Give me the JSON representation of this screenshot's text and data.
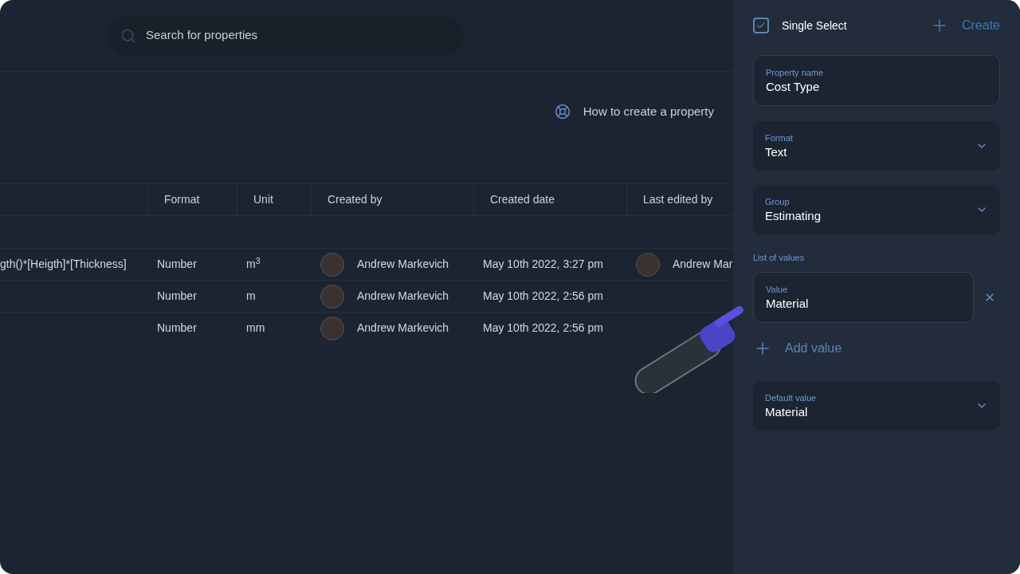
{
  "search": {
    "placeholder": "Search for properties"
  },
  "help_link": "How to create a property",
  "table": {
    "columns": [
      "Format",
      "Unit",
      "Created by",
      "Created date",
      "Last edited by"
    ],
    "rows": [
      {
        "column_1": "gth()*[Heigth]*[Thickness]",
        "format": "Number",
        "unit": "m$^{3}$",
        "created_by": "Andrew Markevich",
        "created_date": "May 10th 2022, 3:27 pm",
        "last_edited_by": "Andrew Mar"
      },
      {
        "format": "Number",
        "unit": "m",
        "created_by": "Andrew Markevich",
        "created_date": "May 10th 2022, 2:56 pm"
      },
      {
        "format": "Number",
        "unit": "mm",
        "created_by": "Andrew Markevich",
        "created_date": "May 10th 2022, 2:56 pm"
      }
    ]
  },
  "panel": {
    "single_select": {
      "label": "Single Select",
      "checked": true
    },
    "create_button": "Create",
    "property_name": {
      "label": "Property name",
      "value": "Cost Type"
    },
    "format": {
      "label": "Format",
      "value": "Text"
    },
    "group": {
      "label": "Group",
      "value": "Estimating"
    },
    "list_of_values": {
      "title": "List of values",
      "values": [
        {
          "label": "Value",
          "value": "Material"
        }
      ],
      "add_button": "Add value"
    },
    "default_value": {
      "label": "Default value",
      "value": "Material"
    }
  }
}
